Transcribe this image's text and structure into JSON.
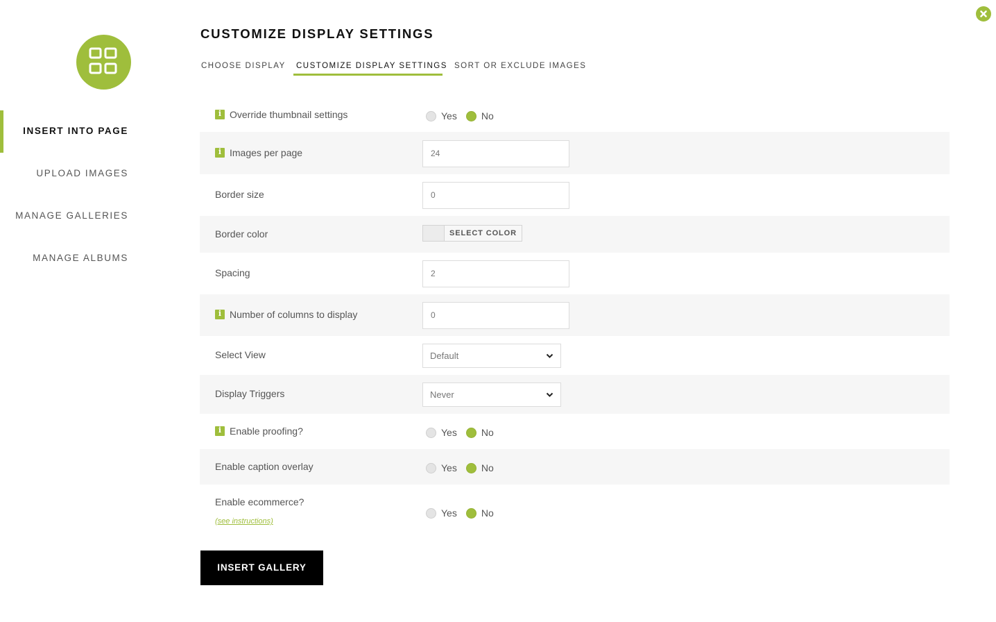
{
  "accent_color": "#9fbe3c",
  "icons": {
    "close": "close-icon",
    "logo": "grid-icon",
    "info": "info-icon",
    "select_chevron": "chevron-down-icon"
  },
  "sidebar": {
    "items": [
      {
        "label": "INSERT INTO PAGE",
        "active": true
      },
      {
        "label": "UPLOAD IMAGES",
        "active": false
      },
      {
        "label": "MANAGE GALLERIES",
        "active": false
      },
      {
        "label": "MANAGE ALBUMS",
        "active": false
      }
    ]
  },
  "header": {
    "title": "CUSTOMIZE DISPLAY SETTINGS",
    "tabs": [
      {
        "label": "CHOOSE DISPLAY",
        "active": false
      },
      {
        "label": "CUSTOMIZE DISPLAY SETTINGS",
        "active": true
      },
      {
        "label": "SORT OR EXCLUDE IMAGES",
        "active": false
      }
    ]
  },
  "settings": {
    "override_thumbnail": {
      "label": "Override thumbnail settings",
      "yes": "Yes",
      "no": "No",
      "value": "No"
    },
    "images_per_page": {
      "label": "Images per page",
      "value": "24"
    },
    "border_size": {
      "label": "Border size",
      "value": "0"
    },
    "border_color": {
      "label": "Border color",
      "button": "SELECT COLOR"
    },
    "spacing": {
      "label": "Spacing",
      "value": "2"
    },
    "num_columns": {
      "label": "Number of columns to display",
      "value": "0"
    },
    "select_view": {
      "label": "Select View",
      "value": "Default"
    },
    "display_triggers": {
      "label": "Display Triggers",
      "value": "Never"
    },
    "enable_proofing": {
      "label": "Enable proofing?",
      "yes": "Yes",
      "no": "No",
      "value": "No"
    },
    "enable_caption_overlay": {
      "label": "Enable caption overlay",
      "yes": "Yes",
      "no": "No",
      "value": "No"
    },
    "enable_ecommerce": {
      "label": "Enable ecommerce?",
      "link": "(see instructions)",
      "yes": "Yes",
      "no": "No",
      "value": "No"
    }
  },
  "actions": {
    "insert_gallery": "INSERT GALLERY"
  }
}
